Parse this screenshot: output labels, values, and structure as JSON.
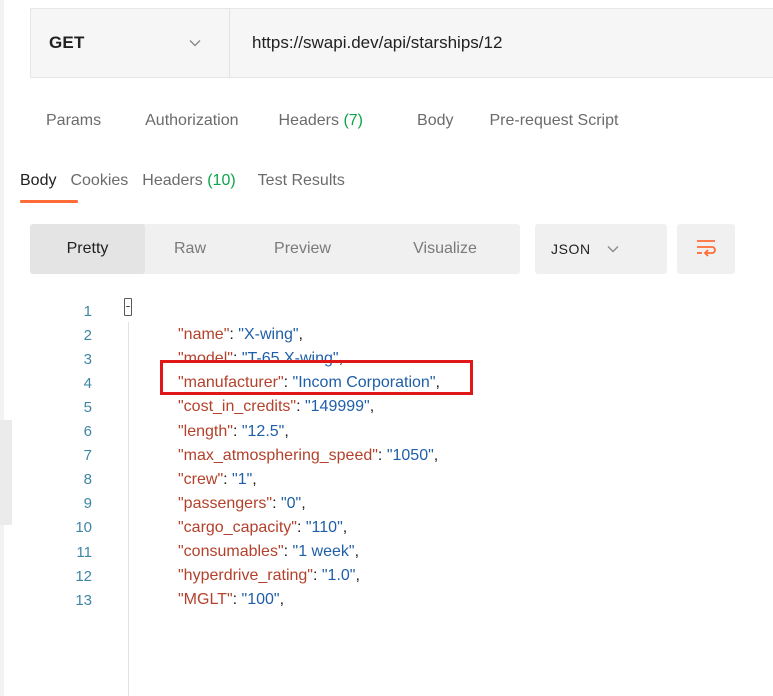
{
  "request": {
    "method": "GET",
    "url": "https://swapi.dev/api/starships/12",
    "tabs": [
      {
        "label": "Params",
        "count": ""
      },
      {
        "label": "Authorization",
        "count": ""
      },
      {
        "label": "Headers",
        "count": "(7)"
      },
      {
        "label": "Body",
        "count": ""
      },
      {
        "label": "Pre-request Script",
        "count": ""
      }
    ]
  },
  "response": {
    "tabs": [
      {
        "label": "Body",
        "count": "",
        "active": true
      },
      {
        "label": "Cookies",
        "count": ""
      },
      {
        "label": "Headers",
        "count": "(10)"
      },
      {
        "label": "Test Results",
        "count": ""
      }
    ],
    "formats": [
      "Pretty",
      "Raw",
      "Preview",
      "Visualize"
    ],
    "active_format": "Pretty",
    "language": "JSON",
    "wrap_icon": "wrap-lines-icon"
  },
  "editor": {
    "open_brace": "{",
    "lines": [
      {
        "n": "1",
        "key": "",
        "value": ""
      },
      {
        "n": "2",
        "key": "\"name\"",
        "value": "\"X-wing\""
      },
      {
        "n": "3",
        "key": "\"model\"",
        "value": "\"T-65 X-wing\""
      },
      {
        "n": "4",
        "key": "\"manufacturer\"",
        "value": "\"Incom Corporation\""
      },
      {
        "n": "5",
        "key": "\"cost_in_credits\"",
        "value": "\"149999\""
      },
      {
        "n": "6",
        "key": "\"length\"",
        "value": "\"12.5\""
      },
      {
        "n": "7",
        "key": "\"max_atmosphering_speed\"",
        "value": "\"1050\""
      },
      {
        "n": "8",
        "key": "\"crew\"",
        "value": "\"1\""
      },
      {
        "n": "9",
        "key": "\"passengers\"",
        "value": "\"0\""
      },
      {
        "n": "10",
        "key": "\"cargo_capacity\"",
        "value": "\"110\""
      },
      {
        "n": "11",
        "key": "\"consumables\"",
        "value": "\"1 week\""
      },
      {
        "n": "12",
        "key": "\"hyperdrive_rating\"",
        "value": "\"1.0\""
      },
      {
        "n": "13",
        "key": "\"MGLT\"",
        "value": "\"100\""
      }
    ],
    "highlighted_line": "3"
  },
  "colors": {
    "accent": "#ff6c37",
    "count_green": "#0ca44a",
    "json_key": "#b3412b",
    "json_string": "#1f5fa8",
    "line_number": "#3f86a4",
    "highlight_box": "#e11717"
  }
}
